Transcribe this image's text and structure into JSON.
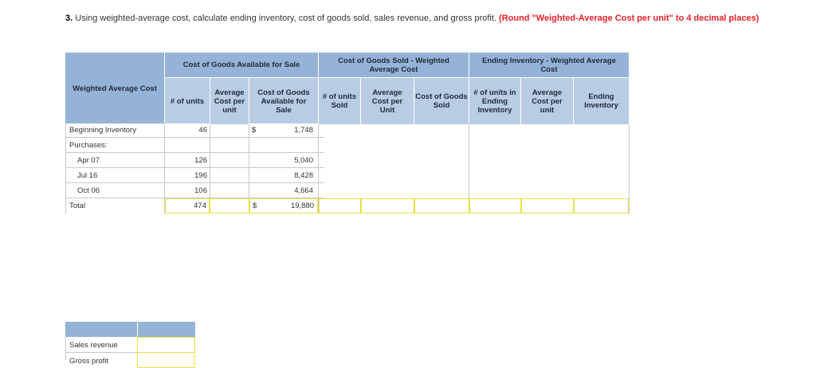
{
  "question": {
    "number": "3.",
    "text": "Using weighted-average cost, calculate ending inventory, cost of goods sold, sales revenue, and gross profit.",
    "note": "(Round \"Weighted-Average Cost per unit\" to 4 decimal places)"
  },
  "table": {
    "corner_label": "Weighted Average Cost",
    "groups": {
      "available": "Cost of Goods Available for Sale",
      "sold": "Cost of Goods Sold - Weighted Average Cost",
      "ending": "Ending Inventory - Weighted Average Cost"
    },
    "columns": {
      "units": "# of units",
      "avg_cost": "Average Cost per unit",
      "cogas": "Cost of Goods Available for Sale",
      "units_sold": "# of units Sold",
      "avg_cost_sold": "Average Cost per Unit",
      "cogs": "Cost of Goods Sold",
      "units_ending": "# of units in Ending Inventory",
      "avg_cost_ending": "Average Cost per unit",
      "ending_inv": "Ending Inventory"
    },
    "rows": [
      {
        "label": "Beginning Inventory",
        "units": "46",
        "dollar": "$",
        "cost": "1,748"
      },
      {
        "label": "Purchases:",
        "units": "",
        "dollar": "",
        "cost": ""
      },
      {
        "label": "Apr 07",
        "units": "126",
        "dollar": "",
        "cost": "5,040"
      },
      {
        "label": "Jul 16",
        "units": "196",
        "dollar": "",
        "cost": "8,428"
      },
      {
        "label": "Oct 06",
        "units": "106",
        "dollar": "",
        "cost": "4,664"
      },
      {
        "label": "Total",
        "units": "474",
        "dollar": "$",
        "cost": "19,880"
      }
    ]
  },
  "summary": {
    "rows": [
      {
        "label": "Sales revenue",
        "value": ""
      },
      {
        "label": "Gross profit",
        "value": ""
      }
    ]
  },
  "colors": {
    "header_dark": "#95b3d7",
    "header_light": "#b8cce4",
    "input_border": "#e7e142",
    "note_red": "#e8202a"
  }
}
